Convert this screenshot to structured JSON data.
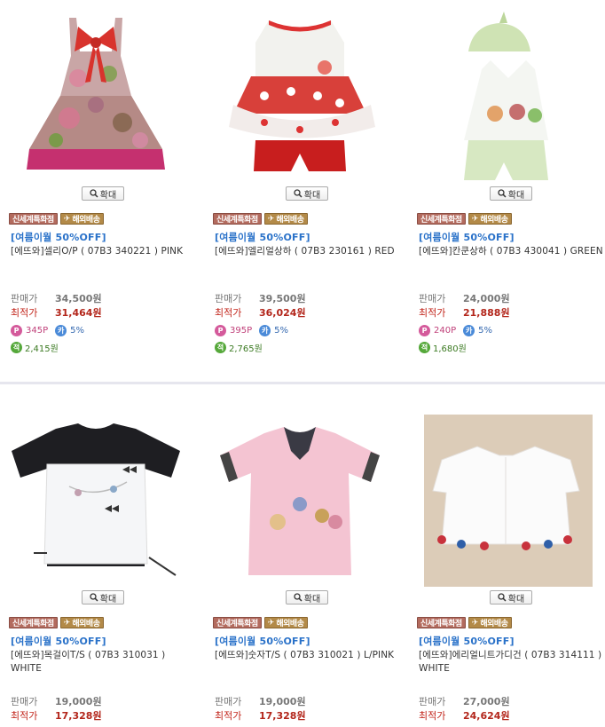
{
  "common": {
    "zoom_label": "확대",
    "badge_new": "신세계특화점",
    "badge_overseas": "해외배송",
    "price_label": "판매가",
    "best_label": "최적가",
    "promo": "[여름이월 50%OFF]",
    "card_rate": "5%"
  },
  "products": [
    {
      "name": "[에뜨와]셀리O/P ( 07B3 340221 ) PINK",
      "price": "34,500원",
      "best": "31,464원",
      "points": "345P",
      "savings": "2,415원",
      "thumb": "pink-dress"
    },
    {
      "name": "[에뜨와]엘리얼상하 ( 07B3 230161 ) RED",
      "price": "39,500원",
      "best": "36,024원",
      "points": "395P",
      "savings": "2,765원",
      "thumb": "red-set"
    },
    {
      "name": "[에뜨와]칸쿤상하 ( 07B3 430041 ) GREEN",
      "price": "24,000원",
      "best": "21,888원",
      "points": "240P",
      "savings": "1,680원",
      "thumb": "green-set"
    },
    {
      "name": "[에뜨와]목걸이T/S ( 07B3 310031 ) WHITE",
      "price": "19,000원",
      "best": "17,328원",
      "thumb": "white-tee"
    },
    {
      "name": "[에뜨와]숫자T/S ( 07B3 310021 ) L/PINK",
      "price": "19,000원",
      "best": "17,328원",
      "thumb": "pink-tee"
    },
    {
      "name": "[에뜨와]에리얼니트가디건 ( 07B3 314111 ) WHITE",
      "price": "27,000원",
      "best": "24,624원",
      "thumb": "white-cardigan"
    }
  ]
}
